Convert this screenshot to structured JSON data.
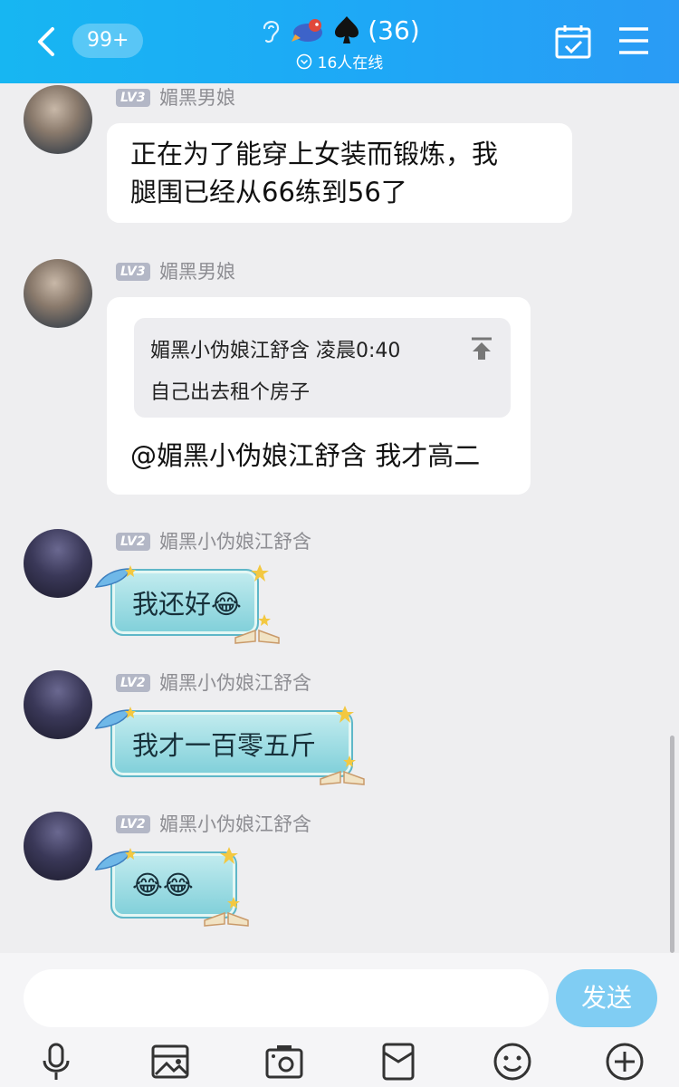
{
  "header": {
    "unread_badge": "99+",
    "group_title": "(36)",
    "online_text": "16人在线",
    "bg_color": "#1ea8f6"
  },
  "messages": [
    {
      "level": "LV3",
      "sender": "媚黑男娘",
      "text_line1": "正在为了能穿上女装而锻炼，我",
      "text_line2": "腿围已经从66练到56了"
    },
    {
      "level": "LV3",
      "sender": "媚黑男娘",
      "quote_header": "媚黑小伪娘江舒含 凌晨0:40",
      "quote_text": "自己出去租个房子",
      "text": "@媚黑小伪娘江舒含 我才高二"
    },
    {
      "level": "LV2",
      "sender": "媚黑小伪娘江舒含",
      "text": "我还好",
      "emoji": "😂"
    },
    {
      "level": "LV2",
      "sender": "媚黑小伪娘江舒含",
      "text": "我才一百零五斤"
    },
    {
      "level": "LV2",
      "sender": "媚黑小伪娘江舒含",
      "text": "😂😂"
    }
  ],
  "input": {
    "placeholder": "",
    "value": "",
    "send_label": "发送"
  },
  "toolbar": {
    "icons": [
      "mic-icon",
      "image-icon",
      "camera-icon",
      "red-packet-icon",
      "emoji-icon",
      "plus-icon"
    ]
  }
}
